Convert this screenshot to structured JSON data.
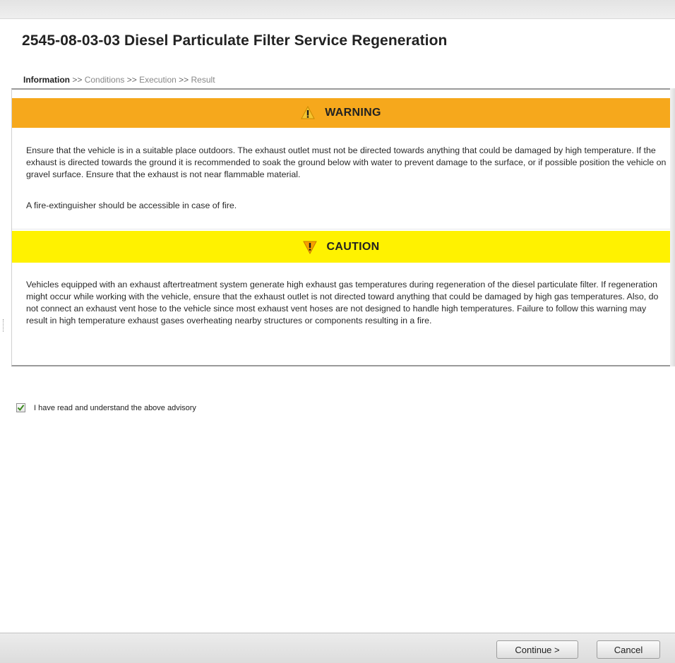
{
  "page": {
    "title": "2545-08-03-03 Diesel Particulate Filter Service Regeneration"
  },
  "breadcrumb": {
    "steps": [
      "Information",
      "Conditions",
      "Execution",
      "Result"
    ],
    "separator": ">>",
    "active_step": "Information"
  },
  "warning": {
    "label": "WARNING",
    "icon": "exclamation-warning-icon",
    "color": "#f6a81c",
    "paragraphs": [
      "Ensure that the vehicle is in a suitable place outdoors. The exhaust outlet must not be directed towards anything that could be damaged by high temperature. If the exhaust is directed towards the ground it is recommended to soak the ground below with water to prevent damage to the surface, or if possible position the vehicle on gravel surface. Ensure that the exhaust is not near flammable material.",
      "A fire-extinguisher should be accessible in case of fire."
    ]
  },
  "caution": {
    "label": "CAUTION",
    "icon": "exclamation-caution-icon",
    "color": "#fff200",
    "paragraphs": [
      "Vehicles equipped with an exhaust aftertreatment system generate high exhaust gas temperatures during regeneration of the diesel particulate filter. If regeneration might occur while working with the vehicle, ensure that the exhaust outlet is not directed toward anything that could be damaged by high gas temperatures. Also, do not connect an exhaust vent hose to the vehicle since most exhaust vent hoses are not designed to handle high temperatures. Failure to follow this warning may result in high temperature exhaust gases overheating nearby structures or components resulting in a fire."
    ]
  },
  "acknowledgement": {
    "label": "I have read and understand the above advisory",
    "checked": true
  },
  "footer": {
    "continue_label": "Continue >",
    "cancel_label": "Cancel"
  }
}
